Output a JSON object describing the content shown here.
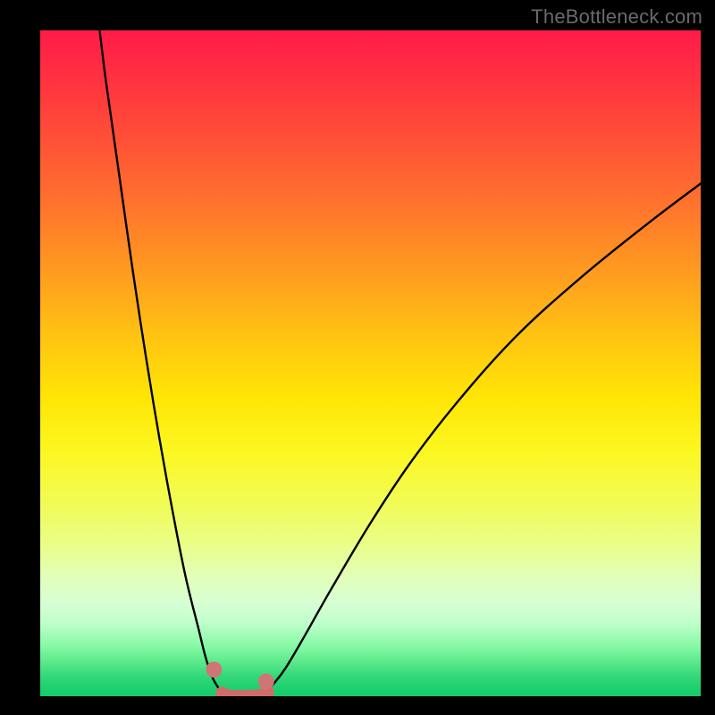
{
  "watermark": "TheBottleneck.com",
  "chart_data": {
    "type": "line",
    "title": "",
    "xlabel": "",
    "ylabel": "",
    "xlim": [
      0,
      100
    ],
    "ylim": [
      0,
      100
    ],
    "grid": false,
    "legend": false,
    "series": [
      {
        "name": "left-branch",
        "x": [
          9,
          10,
          12,
          14,
          16,
          18,
          20,
          22,
          24,
          25,
          26,
          27,
          27.5
        ],
        "y": [
          100,
          92,
          78,
          64,
          51,
          39,
          28,
          18,
          10,
          6,
          3,
          1.2,
          0.5
        ]
      },
      {
        "name": "right-branch",
        "x": [
          34,
          35,
          37,
          40,
          44,
          50,
          56,
          63,
          72,
          82,
          92,
          100
        ],
        "y": [
          0.5,
          1.5,
          4,
          9,
          16,
          26,
          35,
          44,
          54,
          63,
          71,
          77
        ]
      },
      {
        "name": "flat-bottom-marker",
        "x": [
          27.5,
          28,
          28.7,
          29.5,
          30.5,
          31.5,
          32.5,
          33.3,
          34,
          34.5
        ],
        "y": [
          0.5,
          0.2,
          0.05,
          0,
          0,
          0,
          0.05,
          0.15,
          0.35,
          0.6
        ]
      }
    ],
    "markers": [
      {
        "name": "left-end-dot",
        "x": 26.3,
        "y": 4.0
      },
      {
        "name": "right-end-dot",
        "x": 34.2,
        "y": 2.2
      }
    ],
    "colors": {
      "curve": "#000000",
      "marker_stroke": "#cf6b6b",
      "marker_dot": "#d07575"
    }
  }
}
